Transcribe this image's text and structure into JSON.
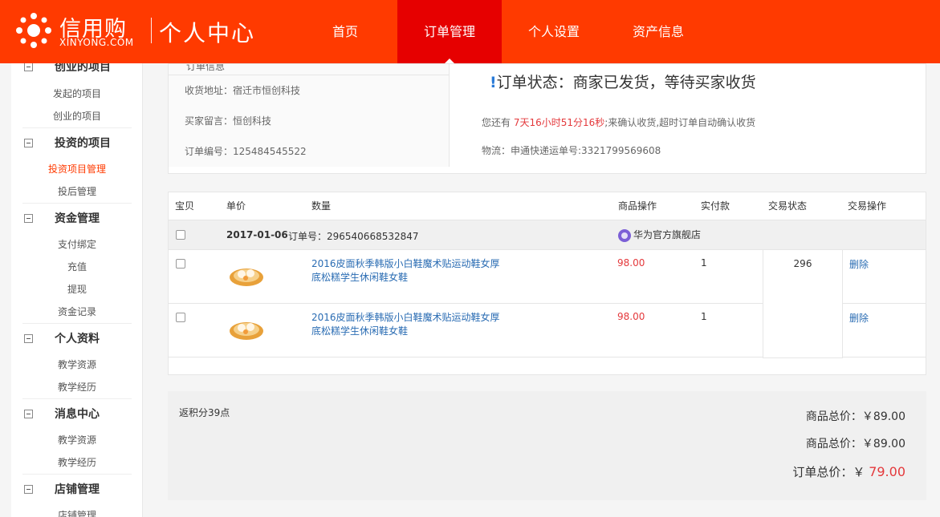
{
  "header": {
    "logo_title": "信用购",
    "logo_sub": "XINYONG.COM",
    "section": "个人中心",
    "nav": [
      "首页",
      "订单管理",
      "个人设置",
      "资产信息"
    ],
    "active_nav": 1
  },
  "sidebar": {
    "groups": [
      {
        "title": "创业的项目",
        "items": [
          "发起的项目",
          "创业的项目"
        ]
      },
      {
        "title": "投资的项目",
        "items": [
          "投资项目管理",
          "投后管理"
        ]
      },
      {
        "title": "资金管理",
        "items": [
          "支付绑定",
          "充值",
          "提现",
          "资金记录"
        ]
      },
      {
        "title": "个人资料",
        "items": [
          "教学资源",
          "教学经历"
        ]
      },
      {
        "title": "消息中心",
        "items": [
          "教学资源",
          "教学经历"
        ]
      },
      {
        "title": "店铺管理",
        "items": [
          "店铺管理"
        ]
      }
    ]
  },
  "order_info": {
    "head": "订单信息",
    "address": "收货地址：宿迁市恒创科技",
    "message": "买家留言：恒创科技",
    "number": "订单编号：125484545522"
  },
  "status": {
    "bang": "!",
    "title": "订单状态：商家已发货，等待买家收货",
    "countdown_prefix": "您还有 ",
    "countdown_time": "7天16小时51分16秒",
    "countdown_suffix": ";来确认收货,超时订单自动确认收货",
    "logistics": "物流：申通快递运单号:3321799569608"
  },
  "table": {
    "headers": [
      "宝贝",
      "单价",
      "数量",
      "商品操作",
      "实付款",
      "交易状态",
      "交易操作"
    ],
    "group": {
      "date": "2017-01-06",
      "order_no": "订单号：296540668532847",
      "shop": "华为官方旗舰店"
    },
    "items": [
      {
        "name": "2016皮面秋季韩版小白鞋魔术贴运动鞋女厚底松糕学生休闲鞋女鞋",
        "price": "98.00",
        "qty": "1",
        "op": "删除"
      },
      {
        "name": "2016皮面秋季韩版小白鞋魔术贴运动鞋女厚底松糕学生休闲鞋女鞋",
        "price": "98.00",
        "qty": "1",
        "op": "删除"
      }
    ],
    "paid": "296"
  },
  "summary": {
    "points": "返积分39点",
    "goods_total_1": "商品总价：￥89.00",
    "goods_total_2": "商品总价：￥89.00",
    "order_total_label": "订单总价：￥",
    "order_total_amount": "79.00"
  },
  "colors": {
    "brand": "#ff3a00",
    "active_nav": "#e60000",
    "price_red": "#e4393c",
    "link_blue": "#2a6cb3"
  }
}
